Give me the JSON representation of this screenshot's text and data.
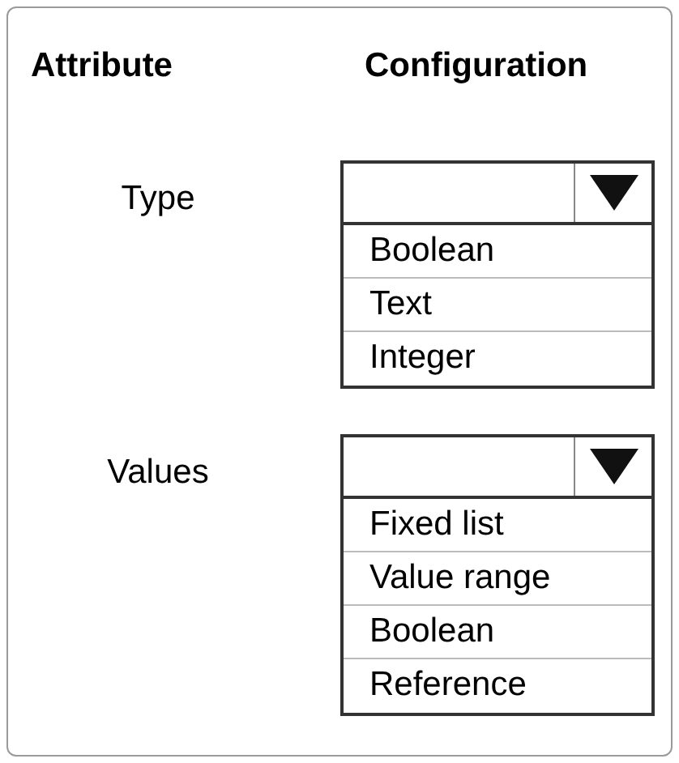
{
  "headers": [
    "Attribute",
    "Configuration"
  ],
  "selects": [
    {
      "label": "Type",
      "options": [
        "Boolean",
        "Text",
        "Integer"
      ]
    },
    {
      "label": "Values",
      "options": [
        "Fixed list",
        "Value range",
        "Boolean",
        "Reference"
      ]
    }
  ]
}
